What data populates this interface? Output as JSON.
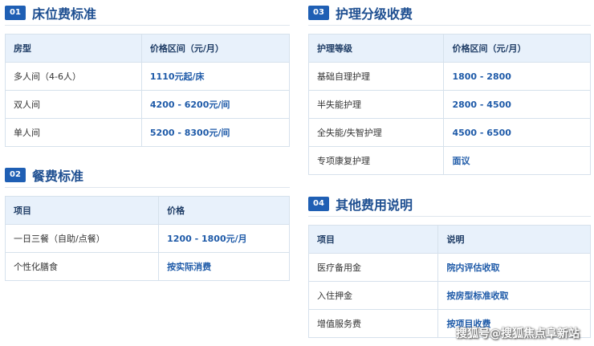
{
  "sections": {
    "s1": {
      "num": "01",
      "title": "床位费标准",
      "headers": [
        "房型",
        "价格区间（元/月）"
      ],
      "rows": [
        [
          "多人间（4-6人）",
          "1110元起/床"
        ],
        [
          "双人间",
          "4200 - 6200元/间"
        ],
        [
          "单人间",
          "5200 - 8300元/间"
        ]
      ]
    },
    "s2": {
      "num": "02",
      "title": "餐费标准",
      "headers": [
        "项目",
        "价格"
      ],
      "rows": [
        [
          "一日三餐（自助/点餐）",
          "1200 - 1800元/月"
        ],
        [
          "个性化膳食",
          "按实际消费"
        ]
      ]
    },
    "s3": {
      "num": "03",
      "title": "护理分级收费",
      "headers": [
        "护理等级",
        "价格区间（元/月）"
      ],
      "rows": [
        [
          "基础自理护理",
          "1800 - 2800"
        ],
        [
          "半失能护理",
          "2800 - 4500"
        ],
        [
          "全失能/失智护理",
          "4500 - 6500"
        ],
        [
          "专项康复护理",
          "面议"
        ]
      ]
    },
    "s4": {
      "num": "04",
      "title": "其他费用说明",
      "headers": [
        "项目",
        "说明"
      ],
      "rows": [
        [
          "医疗备用金",
          "院内评估收取"
        ],
        [
          "入住押金",
          "按房型标准收取"
        ],
        [
          "增值服务费",
          "按项目收费"
        ]
      ]
    }
  },
  "watermark": "搜狐号@搜狐焦点阜新站"
}
